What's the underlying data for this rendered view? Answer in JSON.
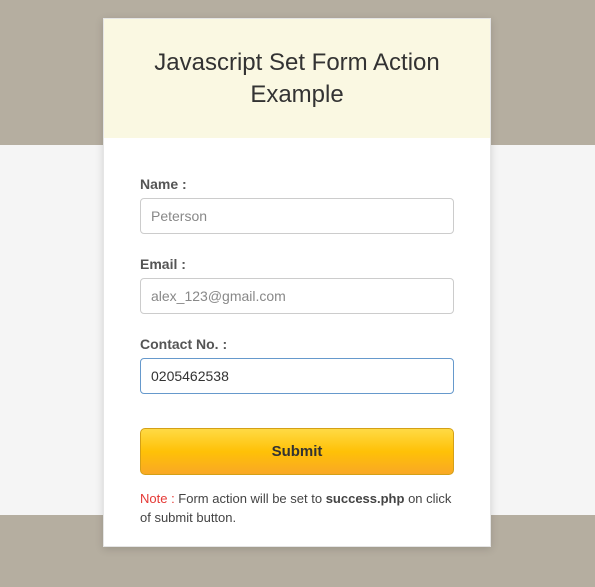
{
  "header": {
    "title": "Javascript Set Form Action Example"
  },
  "form": {
    "name": {
      "label": "Name :",
      "value": "Peterson"
    },
    "email": {
      "label": "Email :",
      "value": "alex_123@gmail.com"
    },
    "contact": {
      "label": "Contact No. :",
      "value": "0205462538"
    },
    "submit_label": "Submit"
  },
  "note": {
    "prefix": "Note :",
    "text_before": " Form action will be set to ",
    "bold_text": "success.php",
    "text_after": " on click of submit button."
  }
}
